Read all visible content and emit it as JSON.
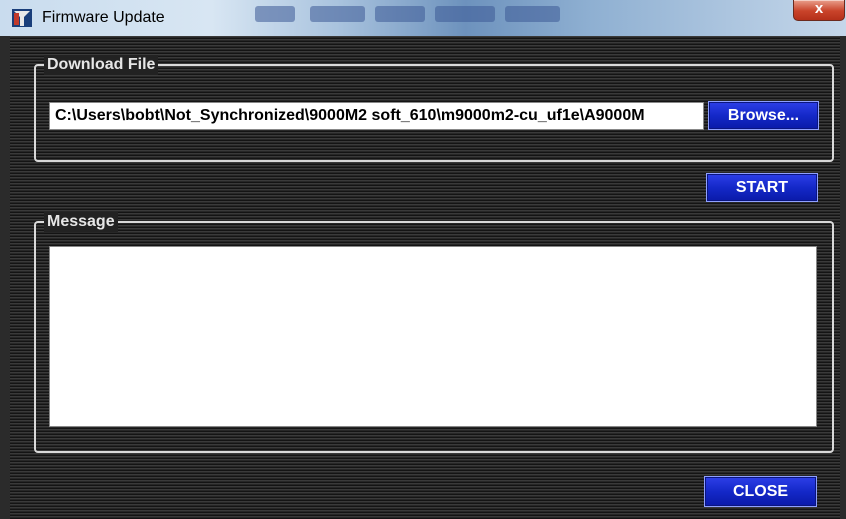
{
  "window": {
    "title": "Firmware Update",
    "close_glyph": "x"
  },
  "download": {
    "legend": "Download File",
    "path_value": "C:\\Users\\bobt\\Not_Synchronized\\9000M2 soft_610\\m9000m2-cu_uf1e\\A9000M",
    "browse_label": "Browse..."
  },
  "start_label": "START",
  "message": {
    "legend": "Message",
    "content": ""
  },
  "close_label": "CLOSE",
  "icons": {
    "app": "app-logo-icon"
  },
  "colors": {
    "button_blue": "#1428c8",
    "background": "#1e1e1e",
    "border": "#d9d9d9"
  }
}
